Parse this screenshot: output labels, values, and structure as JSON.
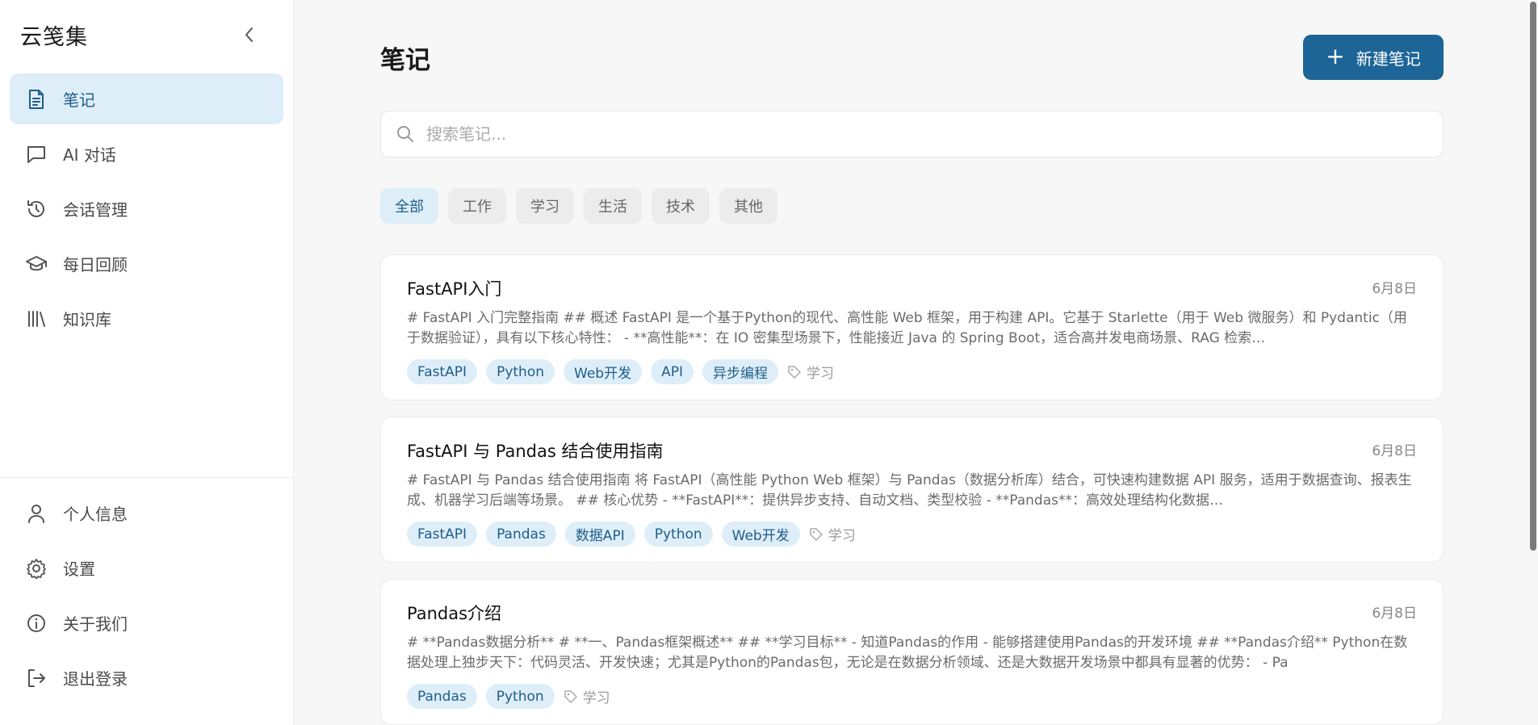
{
  "app": {
    "title": "云笺集"
  },
  "sidebar": {
    "items": [
      {
        "label": "笔记",
        "icon": "file-text-icon",
        "active": true
      },
      {
        "label": "AI 对话",
        "icon": "chat-icon",
        "active": false
      },
      {
        "label": "会话管理",
        "icon": "history-icon",
        "active": false
      },
      {
        "label": "每日回顾",
        "icon": "graduation-cap-icon",
        "active": false
      },
      {
        "label": "知识库",
        "icon": "library-icon",
        "active": false
      }
    ],
    "bottom_items": [
      {
        "label": "个人信息",
        "icon": "user-icon"
      },
      {
        "label": "设置",
        "icon": "gear-icon"
      },
      {
        "label": "关于我们",
        "icon": "info-icon"
      },
      {
        "label": "退出登录",
        "icon": "logout-icon"
      }
    ]
  },
  "main": {
    "title": "笔记",
    "new_button_label": "新建笔记",
    "search_placeholder": "搜索笔记...",
    "filters": [
      "全部",
      "工作",
      "学习",
      "生活",
      "技术",
      "其他"
    ],
    "active_filter": "全部",
    "notes": [
      {
        "title": "FastAPI入门",
        "date": "6月8日",
        "excerpt": "# FastAPI 入门完整指南 ## 概述 FastAPI 是一个基于Python的现代、高性能 Web 框架，用于构建 API。它基于 Starlette（用于 Web 微服务）和 Pydantic（用于数据验证），具有以下核心特性： - **高性能**：在 IO 密集型场景下，性能接近 Java 的 Spring Boot，适合高并发电商场景、RAG 检索…",
        "tags": [
          "FastAPI",
          "Python",
          "Web开发",
          "API",
          "异步编程"
        ],
        "category": "学习"
      },
      {
        "title": "FastAPI 与 Pandas 结合使用指南",
        "date": "6月8日",
        "excerpt": "# FastAPI 与 Pandas 结合使用指南 将 FastAPI（高性能 Python Web 框架）与 Pandas（数据分析库）结合，可快速构建数据 API 服务，适用于数据查询、报表生成、机器学习后端等场景。 ## 核心优势 - **FastAPI**：提供异步支持、自动文档、类型校验 - **Pandas**：高效处理结构化数据…",
        "tags": [
          "FastAPI",
          "Pandas",
          "数据API",
          "Python",
          "Web开发"
        ],
        "category": "学习"
      },
      {
        "title": "Pandas介绍",
        "date": "6月8日",
        "excerpt": "# **Pandas数据分析** # **一、Pandas框架概述** ## **学习目标** - 知道Pandas的作用 - 能够搭建使用Pandas的开发环境 ## **Pandas介绍** Python在数据处理上独步天下：代码灵活、开发快速；尤其是Python的Pandas包，无论是在数据分析领域、还是大数据开发场景中都具有显著的优势： - Pa",
        "tags": [
          "Pandas",
          "Python"
        ],
        "category": "学习"
      }
    ]
  },
  "colors": {
    "accent": "#1d6597",
    "active_bg": "#deeef9",
    "active_text": "#1e5d89"
  }
}
